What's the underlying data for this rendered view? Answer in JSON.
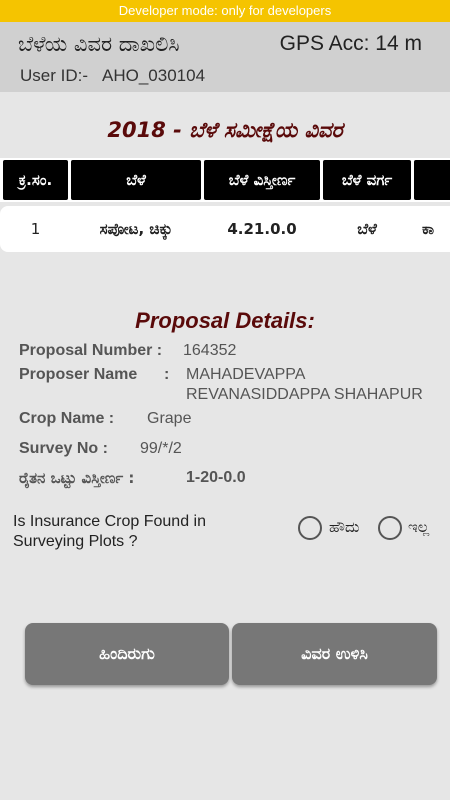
{
  "banner": {
    "text": "Developer mode: only for developers"
  },
  "header": {
    "title": "ಬೆಳೆಯ ವಿವರ ದಾಖಲಿಸಿ",
    "gps": "GPS Acc: 14 m",
    "user_label": "User ID:-",
    "user_id": "AHO_030104"
  },
  "survey": {
    "title": "2018 - ಬೆಳೆ ಸಮೀಕ್ಷೆಯ ವಿವರ",
    "columns": [
      "ಕ್ರ.ಸಂ.",
      "ಬೆಳೆ",
      "ಬೆಳೆ ವಿಸ್ತೀರ್ಣ",
      "ಬೆಳೆ ವರ್ಗ",
      ""
    ],
    "row": [
      "1",
      "ಸಪೋಟ, ಚಿಕ್ಕು",
      "4.21.0.0",
      "ಬೆಳೆ",
      "ಕಾ"
    ]
  },
  "proposal": {
    "heading": "Proposal Details:",
    "number_label": "Proposal Number :",
    "number": "164352",
    "proposer_label": "Proposer Name",
    "proposer_colon": ":",
    "proposer_line1": "MAHADEVAPPA",
    "proposer_line2": "REVANASIDDAPPA SHAHAPUR",
    "crop_label": "Crop Name :",
    "crop": "Grape",
    "survey_label": "Survey No :",
    "survey_no": "99/*/2",
    "area_label": "ರೈತನ ಒಟ್ಟು ವಿಸ್ತೀರ್ಣ :",
    "area": "1-20-0.0"
  },
  "question": {
    "text": "Is Insurance Crop Found in Surveying Plots ?",
    "yes": "ಹೌದು",
    "no": "ಇಲ್ಲ"
  },
  "buttons": {
    "back": "ಹಿಂದಿರುಗು",
    "save": "ವಿವರ ಉಳಿಸಿ"
  }
}
